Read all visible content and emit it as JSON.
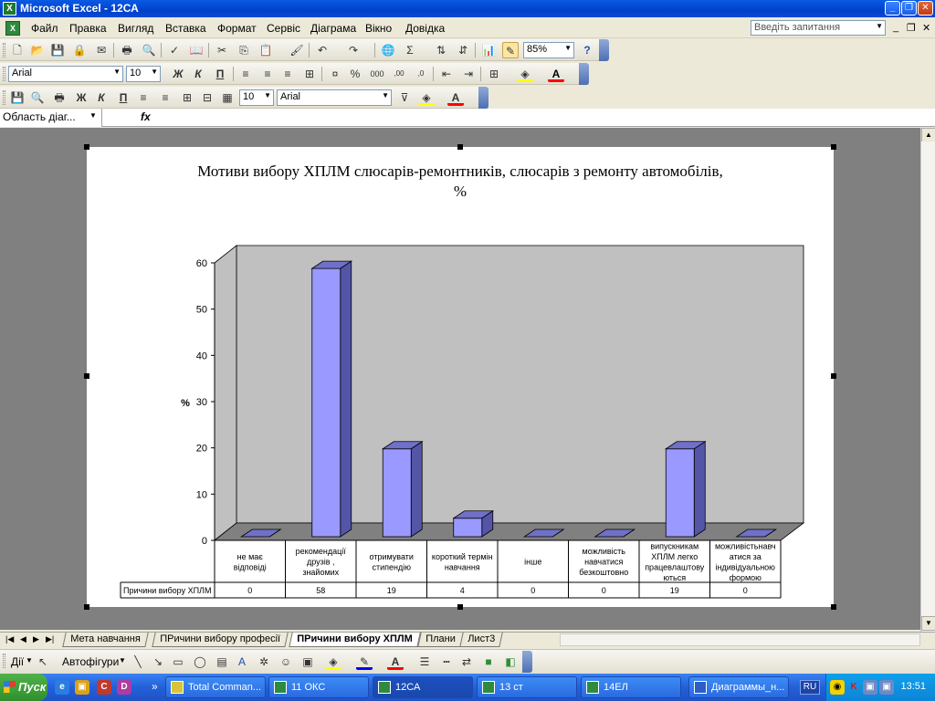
{
  "window": {
    "title": "Microsoft Excel - 12СА",
    "icon": "excel-icon"
  },
  "menu": {
    "items": [
      "Файл",
      "Правка",
      "Вигляд",
      "Вставка",
      "Формат",
      "Сервіс",
      "Діаграма",
      "Вікно",
      "Довідка"
    ],
    "ask_placeholder": "Введіть запитання"
  },
  "toolbar_standard": {
    "zoom": "85%"
  },
  "toolbar_formatting": {
    "font": "Arial",
    "size": "10"
  },
  "toolbar_chart": {
    "size": "10",
    "font": "Arial"
  },
  "formula_bar": {
    "name_box": "Область діаг...",
    "fx": "fx"
  },
  "chart_data": {
    "type": "bar",
    "title": "Мотиви вибору ХПЛМ слюсарів-ремонтників, слюсарів з ремонту автомобілів, %",
    "ylabel": "%",
    "ylim": [
      0,
      60
    ],
    "yticks": [
      "0",
      "10",
      "20",
      "30",
      "40",
      "50",
      "60"
    ],
    "categories": [
      "не має відповіді",
      "рекомендації друзів , знайомих",
      "отримувати стипендію",
      "короткий термін навчання",
      "інше",
      "можливість навчатися безкоштовно",
      "випускникам ХПЛМ легко працевлаштову ються",
      "можливістьнавч атися за індивідуальною формою"
    ],
    "series": [
      {
        "name": "Причини вибору ХПЛМ",
        "values": [
          0,
          58,
          19,
          4,
          0,
          0,
          19,
          0
        ]
      }
    ],
    "table_values": [
      "0",
      "58",
      "19",
      "4",
      "0",
      "0",
      "19",
      "0"
    ],
    "colors": {
      "bar_front": "#9999ff",
      "bar_side": "#5555a8",
      "bar_top": "#7070c8",
      "wall": "#c0c0c0",
      "floor": "#808080"
    }
  },
  "sheet_tabs": [
    "Мета навчання",
    "ПРичини вибору професії",
    "ПРичини вибору ХПЛМ",
    "Плани",
    "Лист3"
  ],
  "active_tab_index": 2,
  "drawing_toolbar": {
    "actions": "Дії",
    "autoshapes": "Автофігури"
  },
  "taskbar": {
    "start": "Пуск",
    "buttons": [
      "Total Comman...",
      "11 ОКС",
      "12СА",
      "13 ст",
      "14ЕЛ",
      "Диаграммы_н..."
    ],
    "active_index": 2,
    "language": "RU",
    "clock": "13:51"
  }
}
